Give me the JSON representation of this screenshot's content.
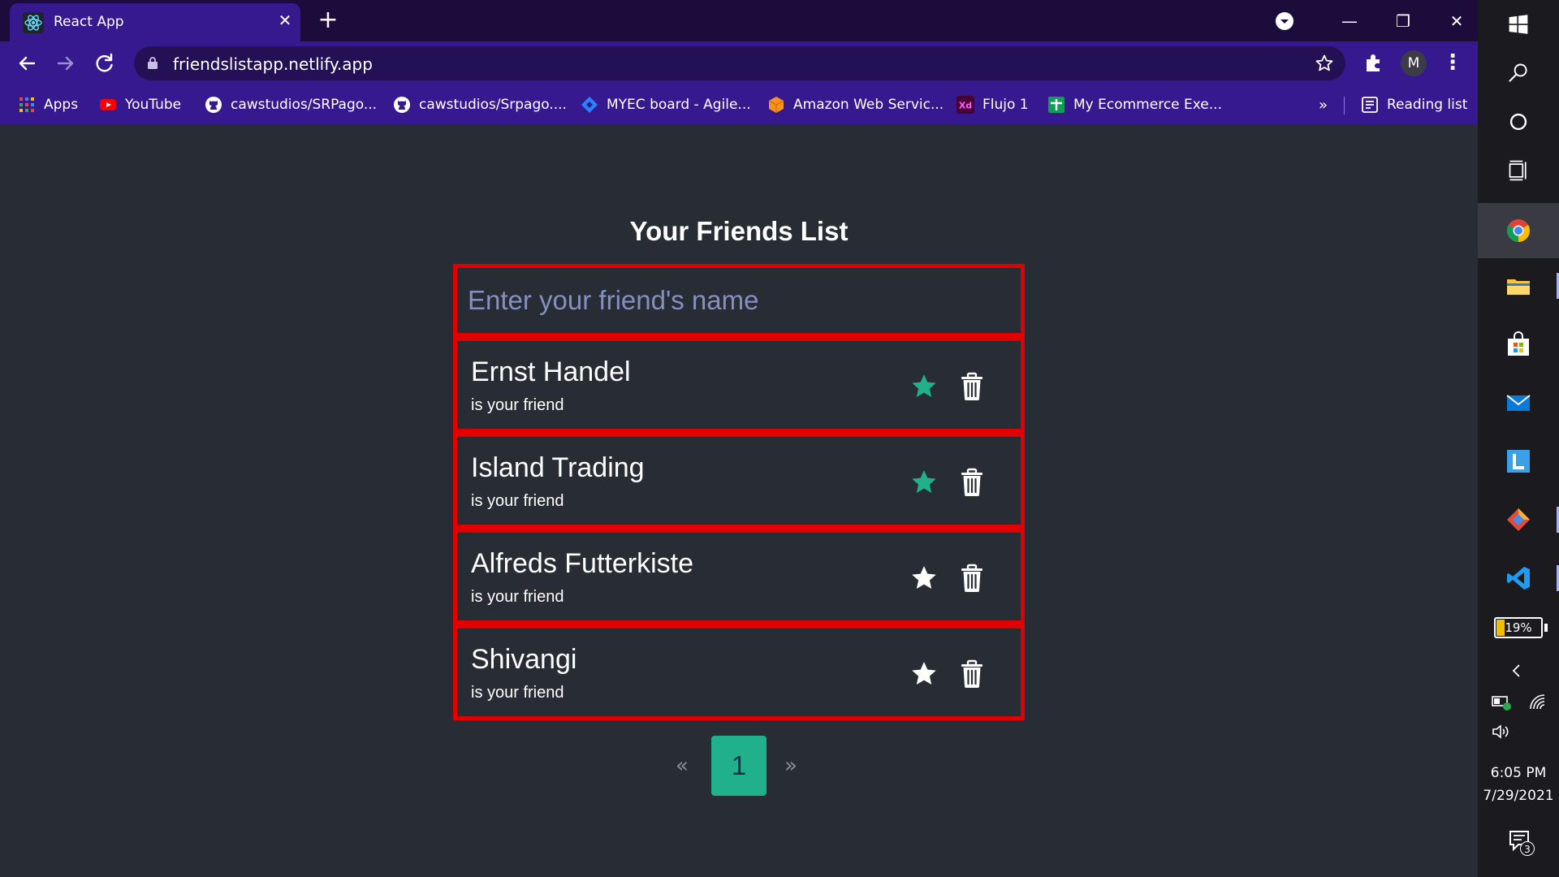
{
  "browser": {
    "tab": {
      "title": "React App",
      "close_glyph": "✕",
      "favicon": "react-icon"
    },
    "new_tab_glyph": "+",
    "window": {
      "minimize": "—",
      "restore": "❐",
      "close": "✕"
    },
    "url": "friendslistapp.netlify.app",
    "profile_initial": "M",
    "menu_glyph": "⋮",
    "bookmarks": [
      {
        "label": "Apps",
        "icon": "apps-grid-icon"
      },
      {
        "label": "YouTube",
        "icon": "youtube-icon"
      },
      {
        "label": "cawstudios/SRPago...",
        "icon": "github-icon"
      },
      {
        "label": "cawstudios/Srpago....",
        "icon": "github-icon"
      },
      {
        "label": "MYEC board - Agile...",
        "icon": "jira-icon"
      },
      {
        "label": "Amazon Web Servic...",
        "icon": "aws-icon"
      },
      {
        "label": "Flujo 1",
        "icon": "adobe-xd-icon"
      },
      {
        "label": "My Ecommerce Exe...",
        "icon": "sheets-icon"
      }
    ],
    "bookmarks_more": "»",
    "reading_list": "Reading list"
  },
  "page": {
    "title": "Your Friends List",
    "input_placeholder": "Enter your friend's name",
    "friends": [
      {
        "name": "Ernst Handel",
        "subtitle": "is your friend",
        "favorite": true
      },
      {
        "name": "Island Trading",
        "subtitle": "is your friend",
        "favorite": true
      },
      {
        "name": "Alfreds Futterkiste",
        "subtitle": "is your friend",
        "favorite": false
      },
      {
        "name": "Shivangi",
        "subtitle": "is your friend",
        "favorite": false
      }
    ],
    "pagination": {
      "prev": "«",
      "current": "1",
      "next": "»"
    }
  },
  "colors": {
    "page_bg": "#282c34",
    "browser_frame": "#36198f",
    "border_red": "#e00000",
    "favorite_star": "#21b08c",
    "default_star": "#ffffff",
    "pagination_active": "#21b08c"
  },
  "taskbar": {
    "battery": "19%",
    "time": "6:05 PM",
    "date": "7/29/2021",
    "notifications": "3"
  }
}
